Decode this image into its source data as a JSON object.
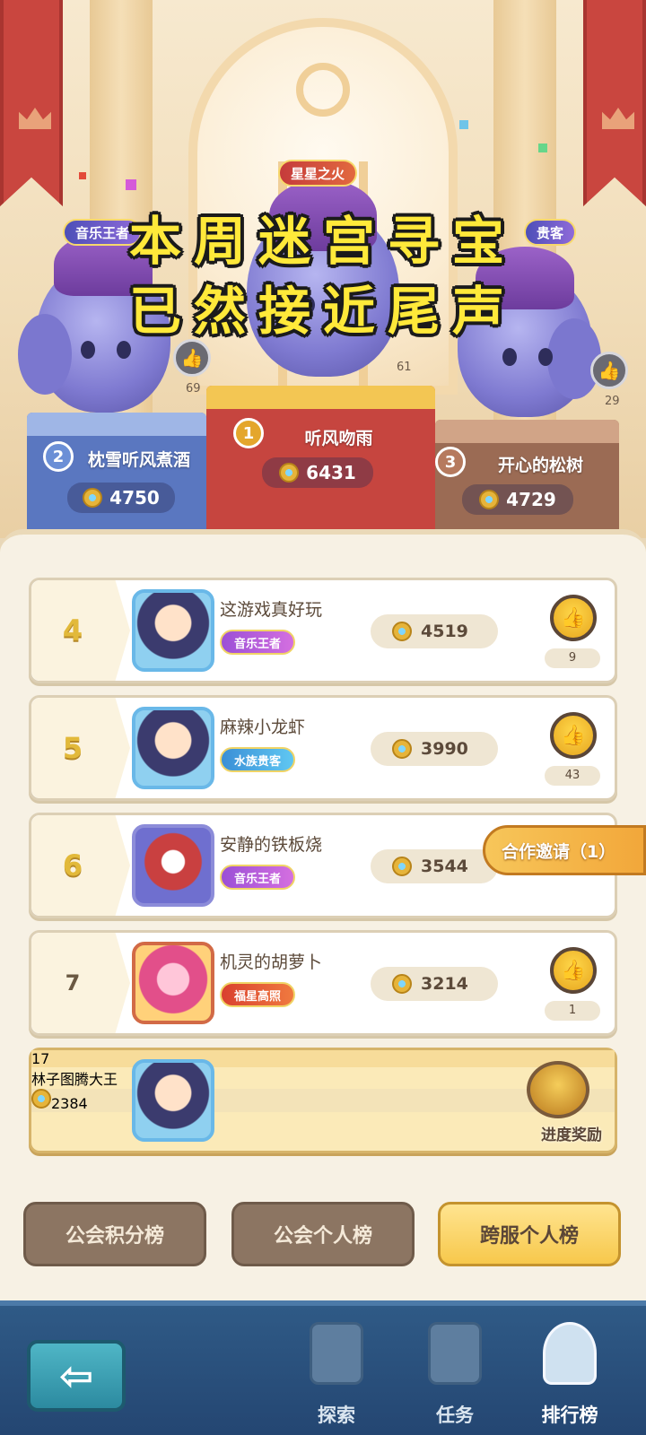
{
  "overlay_caption": {
    "line1": "本周迷宫寻宝",
    "line2": "已然接近尾声"
  },
  "podium": {
    "first": {
      "rank": "1",
      "name": "听风吻雨",
      "score": "6431",
      "title": "星星之火",
      "likes": "61"
    },
    "second": {
      "rank": "2",
      "name": "枕雪听风煮酒",
      "score": "4750",
      "title": "音乐王者",
      "likes": "69"
    },
    "third": {
      "rank": "3",
      "name": "开心的松树",
      "score": "4729",
      "title": "贵客",
      "likes": "29"
    }
  },
  "rankings": [
    {
      "rank": "4",
      "name": "这游戏真好玩",
      "tag": "音乐王者",
      "score": "4519",
      "likes": "9"
    },
    {
      "rank": "5",
      "name": "麻辣小龙虾",
      "tag": "水族贵客",
      "score": "3990",
      "likes": "43"
    },
    {
      "rank": "6",
      "name": "安静的铁板烧",
      "tag": "音乐王者",
      "score": "3544",
      "likes": ""
    },
    {
      "rank": "7",
      "name": "机灵的胡萝卜",
      "tag": "福星高照",
      "score": "3214",
      "likes": "1"
    }
  ],
  "coop_invite": "合作邀请（1）",
  "my_rank": {
    "rank": "17",
    "name": "林子图腾大王",
    "score": "2384",
    "reward_label": "进度奖励"
  },
  "tabs": [
    {
      "label": "公会积分榜",
      "active": false
    },
    {
      "label": "公会个人榜",
      "active": false
    },
    {
      "label": "跨服个人榜",
      "active": true
    }
  ],
  "nav": {
    "back_icon": "arrow-left-icon",
    "items": [
      {
        "label": "探索",
        "icon": "explore-icon"
      },
      {
        "label": "任务",
        "icon": "task-icon"
      },
      {
        "label": "排行榜",
        "icon": "trophy-icon",
        "active": true
      }
    ]
  },
  "colors": {
    "accent": "#f7c84b",
    "banner": "#c9463f",
    "nav": "#244672",
    "caption": "#ffe93a"
  }
}
